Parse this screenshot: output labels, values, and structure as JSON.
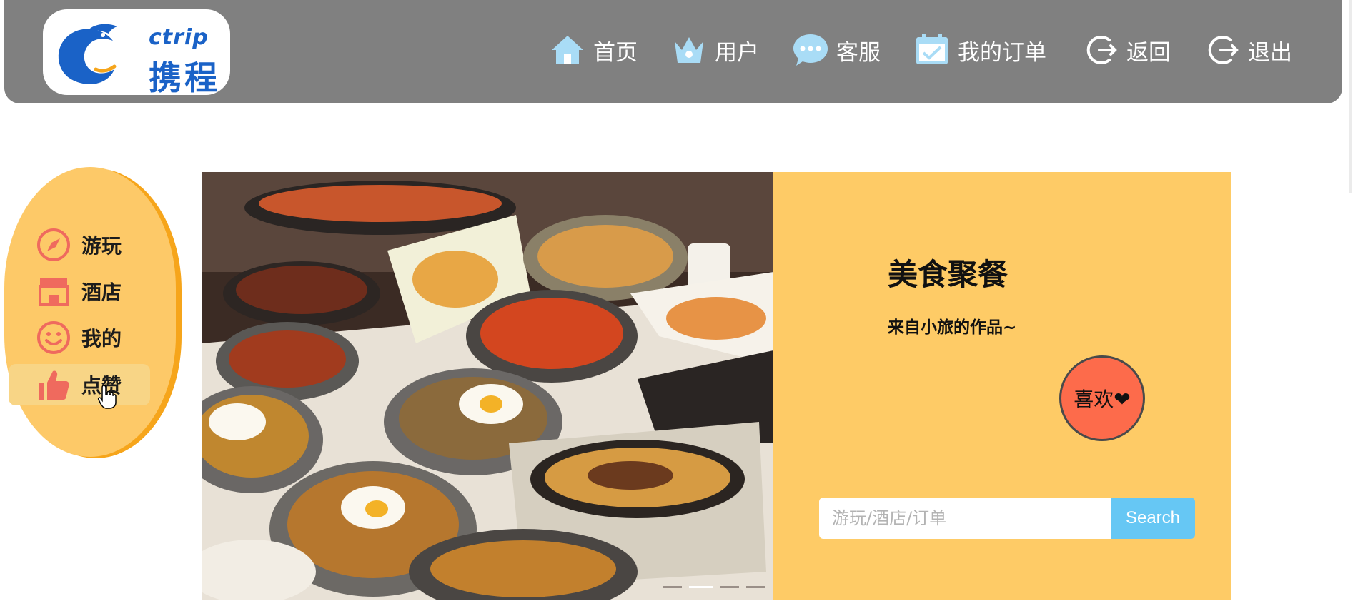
{
  "header": {
    "logo": {
      "text_en": "ctrip",
      "text_cn": "携程"
    },
    "nav": [
      {
        "label": "首页",
        "icon": "home-icon"
      },
      {
        "label": "用户",
        "icon": "crown-icon"
      },
      {
        "label": "客服",
        "icon": "chat-bubble-icon"
      },
      {
        "label": "我的订单",
        "icon": "calendar-icon"
      },
      {
        "label": "返回",
        "icon": "back-arrow-icon"
      },
      {
        "label": "退出",
        "icon": "logout-icon"
      }
    ]
  },
  "sidebar": {
    "items": [
      {
        "label": "游玩",
        "icon": "compass-icon"
      },
      {
        "label": "酒店",
        "icon": "store-icon"
      },
      {
        "label": "我的",
        "icon": "smiley-icon"
      },
      {
        "label": "点赞",
        "icon": "thumbs-up-icon",
        "active": true
      }
    ]
  },
  "banner": {
    "image": "food-table-photo",
    "slide_count": 4,
    "active_slide": 2
  },
  "panel": {
    "title": "美食聚餐",
    "subtitle": "来自小旅的作品~",
    "like_label": "喜欢❤",
    "search_placeholder": "游玩/酒店/订单",
    "search_button": "Search"
  },
  "colors": {
    "header_bg": "#808080",
    "sidebar_bg": "#fdc968",
    "sidebar_accent": "#f6a51b",
    "panel_bg": "#fecb66",
    "like_button": "#fd6b4b",
    "search_button": "#66c7f4",
    "nav_icon": "#a9dcf6",
    "sidebar_icon": "#ef6a5e",
    "logo_blue": "#1a62c7"
  }
}
